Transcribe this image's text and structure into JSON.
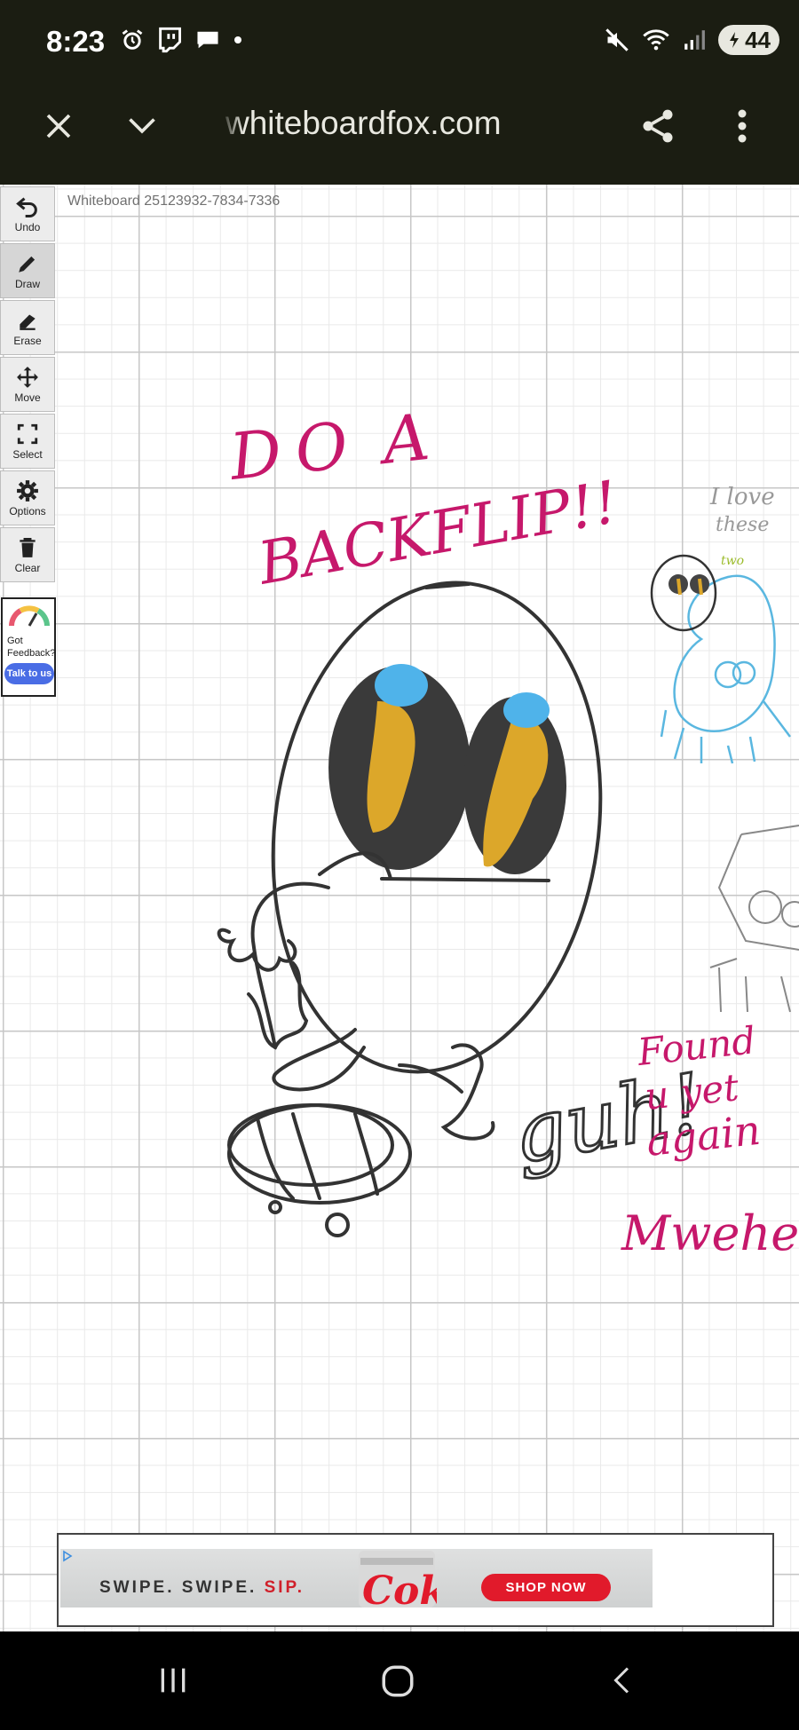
{
  "status_bar": {
    "time": "8:23",
    "battery": "44",
    "left_icons": [
      "alarm-icon",
      "twitch-icon",
      "chat-bubble-icon",
      "dot-icon"
    ],
    "right_icons": [
      "mute-icon",
      "wifi-icon",
      "signal-icon",
      "battery-icon"
    ]
  },
  "browser": {
    "url": "whiteboardfox.com",
    "close_icon": "close-icon",
    "expand_icon": "chevron-down-icon",
    "share_icon": "share-icon",
    "menu_icon": "more-vert-icon"
  },
  "whiteboard": {
    "label": "Whiteboard 25123932-7834-7336"
  },
  "toolbar": {
    "items": [
      {
        "label": "Undo",
        "icon": "undo-icon"
      },
      {
        "label": "Draw",
        "icon": "pencil-icon"
      },
      {
        "label": "Erase",
        "icon": "eraser-icon"
      },
      {
        "label": "Move",
        "icon": "move-icon"
      },
      {
        "label": "Select",
        "icon": "select-icon"
      },
      {
        "label": "Options",
        "icon": "gear-icon"
      },
      {
        "label": "Clear",
        "icon": "trash-icon"
      }
    ],
    "active": "Draw"
  },
  "feedback": {
    "line1": "Got",
    "line2": "Feedback?",
    "button": "Talk to us"
  },
  "canvas_text": {
    "do_a_backflip": "DO A BACKFLIP!!",
    "i_love": "I love these two",
    "found_you": "Found u yet again",
    "muhehe": "Mwehehe",
    "guh": "guh!"
  },
  "ad": {
    "text_main": "SWIPE. SWIPE. ",
    "text_accent": "SIP.",
    "button": "SHOP NOW",
    "brand": "Coke"
  },
  "colors": {
    "bars": "#1b1d12",
    "magenta_ink": "#c6186b",
    "blue_ink": "#5ab7e0",
    "feedback_button": "#4a6de5",
    "ad_button": "#e11a2b"
  }
}
